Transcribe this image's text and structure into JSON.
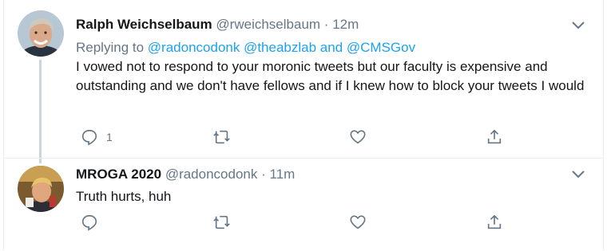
{
  "tweets": [
    {
      "name": "Ralph Weichselbaum",
      "handle": "@rweichselbaum",
      "separator": "·",
      "time": "12m",
      "replying_to_prefix": "Replying to",
      "replying_to_users": "@radoncodonk @theabzlab and @CMSGov",
      "text": "I vowed not to respond to your moronic tweets but our faculty is expensive and outstanding and we don't have fellows and if I knew how to block your tweets I would",
      "reply_count": "1",
      "avatar_icon": "profile-photo"
    },
    {
      "name": "MROGA 2020",
      "handle": "@radoncodonk",
      "separator": "·",
      "time": "11m",
      "text": "Truth hurts, huh",
      "avatar_icon": "profile-photo"
    }
  ],
  "icons": {
    "reply": "speech-bubble-icon",
    "retweet": "retweet-icon",
    "like": "heart-icon",
    "share": "share-icon",
    "more": "chevron-down-icon"
  },
  "colors": {
    "text": "#14171a",
    "secondary": "#657786",
    "link": "#1da1f2",
    "border": "#e6ecf0",
    "thread_line": "#ccd6dd"
  }
}
